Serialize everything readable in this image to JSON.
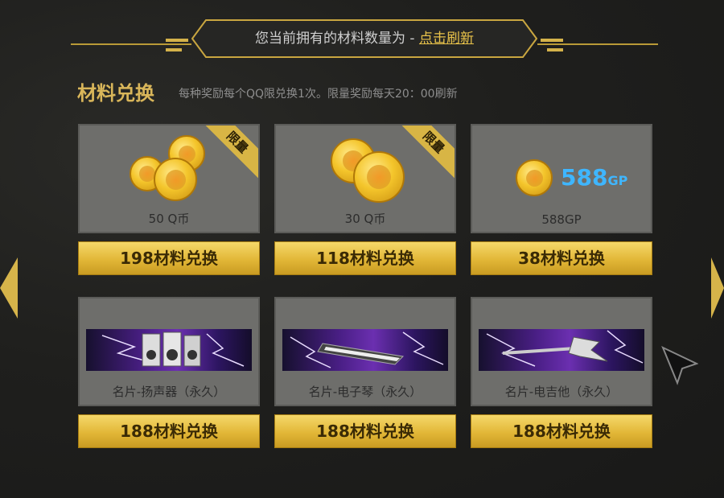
{
  "header": {
    "message": "您当前拥有的材料数量为 - ",
    "refresh_label": "点击刷新"
  },
  "section": {
    "title": "材料兑换",
    "note": "每种奖励每个QQ限兑换1次。限量奖励每天20：00刷新"
  },
  "badges": {
    "limited": "限量"
  },
  "items": [
    {
      "name": "50 Q币",
      "cost": "198材料",
      "action": "兑换",
      "limited": true,
      "icon": "coins-icon"
    },
    {
      "name": "30 Q币",
      "cost": "118材料",
      "action": "兑换",
      "limited": true,
      "icon": "coins-icon"
    },
    {
      "name": "588GP",
      "cost": "38材料",
      "action": "兑换",
      "limited": false,
      "icon": "gp-coin-icon",
      "icon_text": "588",
      "icon_unit": "GP"
    },
    {
      "name": "名片-扬声器（永久）",
      "cost": "188材料",
      "action": "兑换",
      "limited": false,
      "icon": "speaker-banner-icon"
    },
    {
      "name": "名片-电子琴（永久）",
      "cost": "188材料",
      "action": "兑换",
      "limited": false,
      "icon": "keyboard-banner-icon"
    },
    {
      "name": "名片-电吉他（永久）",
      "cost": "188材料",
      "action": "兑换",
      "limited": false,
      "icon": "guitar-banner-icon"
    }
  ],
  "colors": {
    "accent": "#d9b65a",
    "button": "#e2b737",
    "panel": "#6e6e6b",
    "gp": "#3fb6ff"
  }
}
